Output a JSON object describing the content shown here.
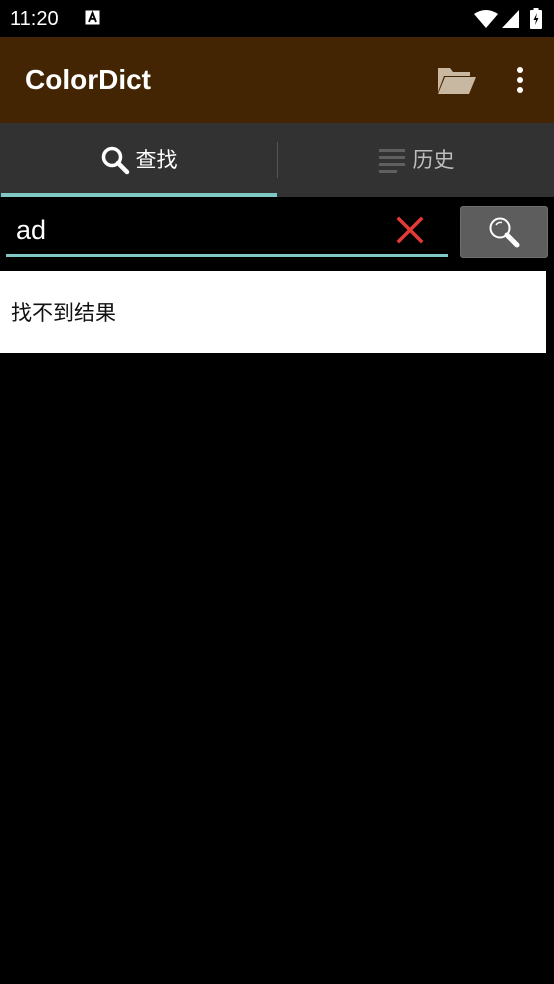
{
  "status_bar": {
    "time": "11:20"
  },
  "app_bar": {
    "title": "ColorDict",
    "bg_color": "#442503"
  },
  "tabs": [
    {
      "label": "查找",
      "icon": "search-icon",
      "active": true
    },
    {
      "label": "历史",
      "icon": "list-icon",
      "active": false
    }
  ],
  "search": {
    "value": "ad",
    "clear_icon": "close-icon",
    "button_icon": "search-icon"
  },
  "result": {
    "message": "找不到结果"
  },
  "colors": {
    "accent": "#7fc7c3",
    "clear": "#e53935",
    "tab_bar": "#323232",
    "button": "#5d5d5d"
  }
}
